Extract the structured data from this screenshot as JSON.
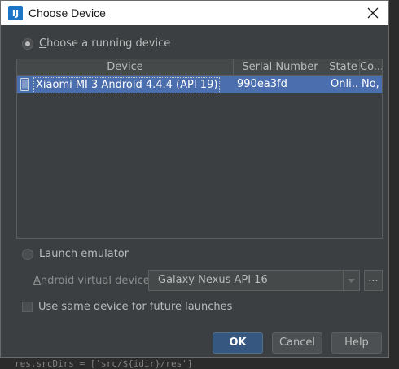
{
  "window": {
    "title": "Choose Device",
    "app_icon": "intellij-icon"
  },
  "running_section": {
    "label": "Choose a running device",
    "selected": true
  },
  "device_table": {
    "columns": [
      "Device",
      "Serial Number",
      "State",
      "Co..."
    ],
    "rows": [
      {
        "device": "Xiaomi MI 3 Android 4.4.4 (API 19)",
        "serial": "990ea3fd",
        "state": "Onli...",
        "compat": "No,"
      }
    ]
  },
  "emulator_section": {
    "label": "Launch emulator",
    "selected": false,
    "avd_label": "Android virtual device:",
    "avd_value": "Galaxy Nexus API 16",
    "more_label": "..."
  },
  "same_device": {
    "label": "Use same device for future launches",
    "checked": false
  },
  "buttons": {
    "ok": "OK",
    "cancel": "Cancel",
    "help": "Help"
  },
  "background": {
    "bottom_code": "res.srcDirs = ['src/${idir}/res']"
  },
  "colors": {
    "dialog_bg": "#3c3f41",
    "selection": "#4b6eaf",
    "default_button": "#365880"
  }
}
